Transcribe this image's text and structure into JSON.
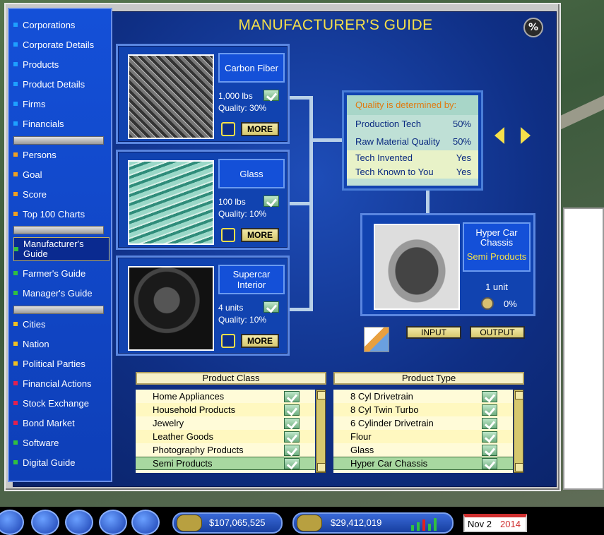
{
  "title": "MANUFACTURER'S GUIDE",
  "pct_icon_label": "%",
  "sidebar": {
    "items": [
      {
        "label": "Corporations",
        "color": "#1ea0ff"
      },
      {
        "label": "Corporate Details",
        "color": "#1ea0ff"
      },
      {
        "label": "Products",
        "color": "#1ea0ff"
      },
      {
        "label": "Product Details",
        "color": "#1ea0ff"
      },
      {
        "label": "Firms",
        "color": "#1ea0ff"
      },
      {
        "label": "Financials",
        "color": "#1ea0ff"
      },
      {
        "label": "Persons",
        "color": "#f0a020"
      },
      {
        "label": "Goal",
        "color": "#f0a020"
      },
      {
        "label": "Score",
        "color": "#f0a020"
      },
      {
        "label": "Top 100 Charts",
        "color": "#f0a020"
      },
      {
        "label": "Manufacturer's Guide",
        "color": "#30c040"
      },
      {
        "label": "Farmer's Guide",
        "color": "#30c040"
      },
      {
        "label": "Manager's Guide",
        "color": "#30c040"
      },
      {
        "label": "Cities",
        "color": "#f0c020"
      },
      {
        "label": "Nation",
        "color": "#f0c020"
      },
      {
        "label": "Political Parties",
        "color": "#f0c020"
      },
      {
        "label": "Financial Actions",
        "color": "#e02050"
      },
      {
        "label": "Stock Exchange",
        "color": "#e02050"
      },
      {
        "label": "Bond Market",
        "color": "#e02050"
      },
      {
        "label": "Software",
        "color": "#30c040"
      },
      {
        "label": "Digital Guide",
        "color": "#30c040"
      }
    ],
    "selected": "Manufacturer's Guide"
  },
  "inputs": [
    {
      "name": "Carbon Fiber",
      "amount": "1,000 lbs",
      "quality": "Quality: 30%",
      "more": "MORE"
    },
    {
      "name": "Glass",
      "amount": "100 lbs",
      "quality": "Quality: 10%",
      "more": "MORE"
    },
    {
      "name": "Supercar Interior",
      "amount": "4 units",
      "quality": "Quality: 10%",
      "more": "MORE"
    }
  ],
  "quality_panel": {
    "header": "Quality is determined by:",
    "rows": [
      {
        "label": "Production Tech",
        "value": "50%"
      },
      {
        "label": "Raw Material Quality",
        "value": "50%"
      },
      {
        "label": "Tech Invented",
        "value": "Yes"
      },
      {
        "label": "Tech Known to You",
        "value": "Yes"
      }
    ]
  },
  "output": {
    "name": "Hyper Car Chassis",
    "category": "Semi Products",
    "units": "1 unit",
    "pct": "0%"
  },
  "buttons": {
    "input": "INPUT",
    "output": "OUTPUT"
  },
  "product_class": {
    "header": "Product Class",
    "rows": [
      "Home Appliances",
      "Household Products",
      "Jewelry",
      "Leather Goods",
      "Photography Products",
      "Semi Products"
    ],
    "selected": "Semi Products"
  },
  "product_type": {
    "header": "Product Type",
    "rows": [
      "8 Cyl Drivetrain",
      "8 Cyl Twin Turbo",
      "6 Cylinder Drivetrain",
      "Flour",
      "Glass",
      "Hyper Car Chassis"
    ],
    "selected": "Hyper Car Chassis"
  },
  "taskbar": {
    "cash": "$107,065,525",
    "profit": "$29,412,019",
    "date_md": "Nov 2",
    "date_year": "2014"
  }
}
